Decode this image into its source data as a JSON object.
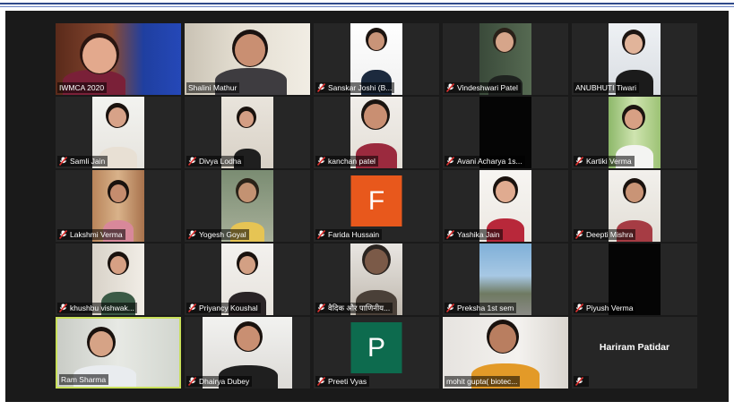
{
  "app": "Zoom gallery view",
  "colors": {
    "active_speaker_border": "#c9e05a",
    "muted_icon": "#e0312f",
    "avatar_f": "#e8581c",
    "avatar_p": "#0d6b4e"
  },
  "participants": [
    {
      "name": "IWMCA 2020",
      "muted": false,
      "type": "video"
    },
    {
      "name": "Shalini Mathur",
      "muted": false,
      "type": "video"
    },
    {
      "name": "Sanskar Joshi (B...",
      "muted": true,
      "type": "video"
    },
    {
      "name": "Vindeshwari Patel",
      "muted": true,
      "type": "video"
    },
    {
      "name": "ANUBHUTI Tiwari",
      "muted": false,
      "type": "video"
    },
    {
      "name": "Samli Jain",
      "muted": true,
      "type": "video"
    },
    {
      "name": "Divya Lodha",
      "muted": true,
      "type": "video"
    },
    {
      "name": "kanchan patel",
      "muted": true,
      "type": "video"
    },
    {
      "name": "Avani Acharya 1s...",
      "muted": true,
      "type": "video"
    },
    {
      "name": "Kartiki Verma",
      "muted": true,
      "type": "video"
    },
    {
      "name": "Lakshmi Verma",
      "muted": true,
      "type": "video"
    },
    {
      "name": "Yogesh Goyal",
      "muted": true,
      "type": "video"
    },
    {
      "name": "Farida Hussain",
      "muted": true,
      "type": "avatar",
      "letter": "F"
    },
    {
      "name": "Yashika Jain",
      "muted": true,
      "type": "video"
    },
    {
      "name": "Deepti Mishra",
      "muted": true,
      "type": "video"
    },
    {
      "name": "khushbu vishwak...",
      "muted": true,
      "type": "video"
    },
    {
      "name": "Priyancy Koushal",
      "muted": true,
      "type": "video"
    },
    {
      "name": "वैदिक और पाणिनीय...",
      "muted": true,
      "type": "video"
    },
    {
      "name": "Preksha 1st sem",
      "muted": true,
      "type": "video"
    },
    {
      "name": "Piyush Verma",
      "muted": true,
      "type": "video"
    },
    {
      "name": "Ram Sharma",
      "muted": false,
      "type": "video",
      "active": true
    },
    {
      "name": "Dhairya Dubey",
      "muted": true,
      "type": "video"
    },
    {
      "name": "Preeti Vyas",
      "muted": true,
      "type": "avatar",
      "letter": "P"
    },
    {
      "name": "mohit gupta( biotec...",
      "muted": false,
      "type": "video"
    },
    {
      "name": "Hariram Patidar",
      "muted": true,
      "type": "name-only"
    }
  ]
}
